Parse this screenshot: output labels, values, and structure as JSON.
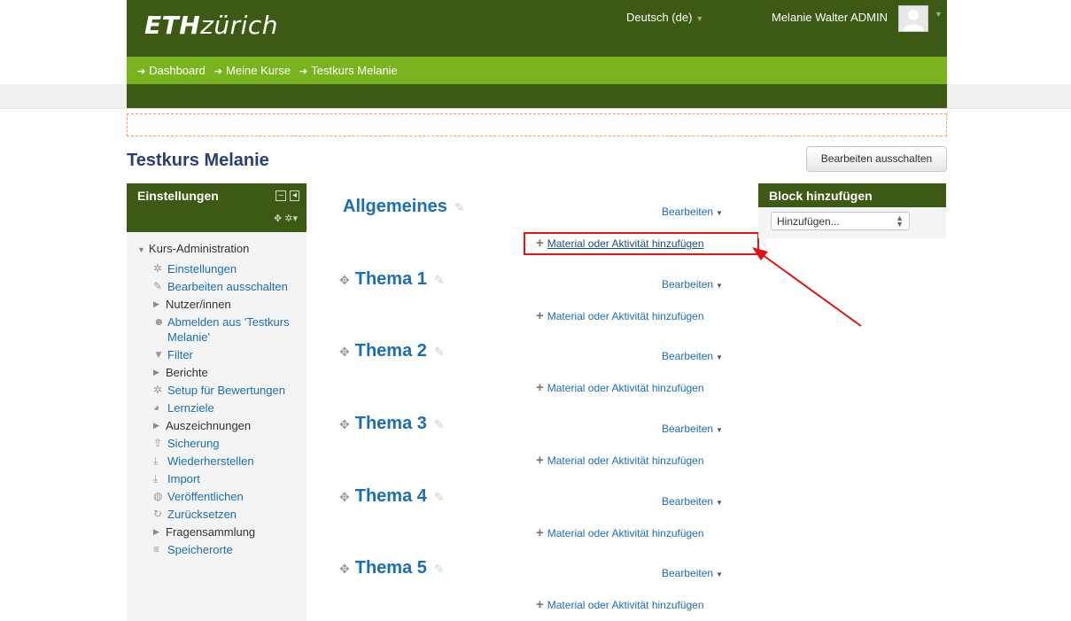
{
  "header": {
    "logo_eth": "ETH",
    "logo_zurich": "zürich",
    "language": "Deutsch (de)",
    "user_name": "Melanie Walter ADMIN"
  },
  "breadcrumb": [
    "Dashboard",
    "Meine Kurse",
    "Testkurs Melanie"
  ],
  "course": {
    "title": "Testkurs Melanie",
    "edit_off_button": "Bearbeiten ausschalten"
  },
  "settings_block": {
    "title": "Einstellungen",
    "root": "Kurs-Administration",
    "items": [
      {
        "label": "Einstellungen",
        "icon": "gear-icon",
        "link": true
      },
      {
        "label": "Bearbeiten ausschalten",
        "icon": "pencil-icon",
        "link": true
      },
      {
        "label": "Nutzer/innen",
        "icon": "expand-triangle-icon",
        "link": false
      },
      {
        "label": "Abmelden aus 'Testkurs Melanie'",
        "icon": "user-icon",
        "link": true
      },
      {
        "label": "Filter",
        "icon": "filter-icon",
        "link": true
      },
      {
        "label": "Berichte",
        "icon": "expand-triangle-icon",
        "link": false
      },
      {
        "label": "Setup für Bewertungen",
        "icon": "gear-icon",
        "link": true
      },
      {
        "label": "Lernziele",
        "icon": "pie-icon",
        "link": true
      },
      {
        "label": "Auszeichnungen",
        "icon": "expand-triangle-icon",
        "link": false
      },
      {
        "label": "Sicherung",
        "icon": "upload-icon",
        "link": true
      },
      {
        "label": "Wiederherstellen",
        "icon": "download-icon",
        "link": true
      },
      {
        "label": "Import",
        "icon": "download-icon",
        "link": true
      },
      {
        "label": "Veröffentlichen",
        "icon": "globe-icon",
        "link": true
      },
      {
        "label": "Zurücksetzen",
        "icon": "reset-icon",
        "link": true
      },
      {
        "label": "Fragensammlung",
        "icon": "expand-triangle-icon",
        "link": false
      },
      {
        "label": "Speicherorte",
        "icon": "database-icon",
        "link": true
      }
    ]
  },
  "sections": [
    {
      "title": "Allgemeines",
      "edit": "Bearbeiten",
      "add": "Material oder Aktivität hinzufügen"
    },
    {
      "title": "Thema 1",
      "edit": "Bearbeiten",
      "add": "Material oder Aktivität hinzufügen"
    },
    {
      "title": "Thema 2",
      "edit": "Bearbeiten",
      "add": "Material oder Aktivität hinzufügen"
    },
    {
      "title": "Thema 3",
      "edit": "Bearbeiten",
      "add": "Material oder Aktivität hinzufügen"
    },
    {
      "title": "Thema 4",
      "edit": "Bearbeiten",
      "add": "Material oder Aktivität hinzufügen"
    },
    {
      "title": "Thema 5",
      "edit": "Bearbeiten",
      "add": "Material oder Aktivität hinzufügen"
    }
  ],
  "add_block": {
    "title": "Block hinzufügen",
    "select_value": "Hinzufügen..."
  },
  "colors": {
    "header_green": "#3d5a14",
    "nav_green": "#77b41e",
    "link_blue": "#1a6fb4",
    "annotation_red": "#e11111"
  }
}
